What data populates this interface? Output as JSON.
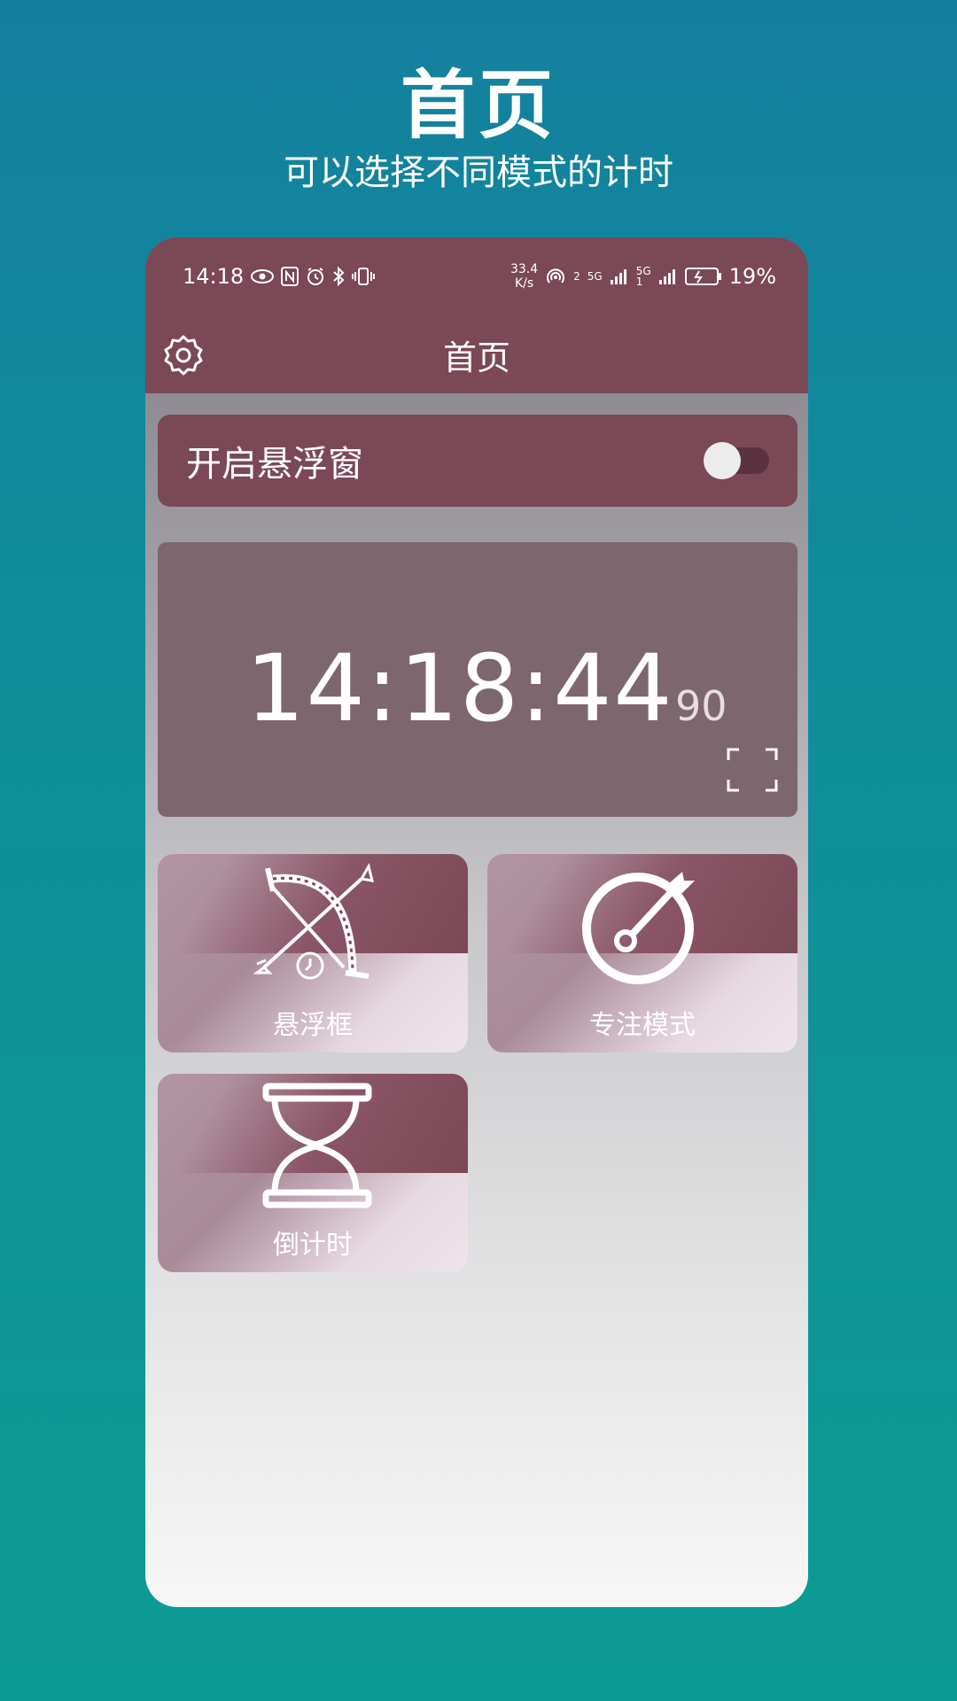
{
  "promo": {
    "title": "首页",
    "subtitle": "可以选择不同模式的计时"
  },
  "status_bar": {
    "time": "14:18",
    "net_speed_value": "33.4",
    "net_speed_unit": "K/s",
    "signal_label_1": "2",
    "signal_label_2": "5G",
    "signal_label_3": "5G",
    "signal_label_4": "1",
    "battery_percent": "19%",
    "icons": [
      "eye-icon",
      "nfc-icon",
      "alarm-icon",
      "bluetooth-icon",
      "vibrate-icon",
      "hotspot-icon",
      "signal-icon",
      "battery-icon"
    ]
  },
  "app_bar": {
    "title": "首页",
    "settings_icon": "gear-icon"
  },
  "float_window": {
    "label": "开启悬浮窗",
    "enabled": false
  },
  "clock": {
    "time": "14:18:44",
    "fraction": "90",
    "fullscreen_icon": "fullscreen-icon"
  },
  "modes": [
    {
      "label": "悬浮框",
      "icon": "bow-arrow-clock-icon"
    },
    {
      "label": "专注模式",
      "icon": "target-icon"
    },
    {
      "label": "倒计时",
      "icon": "hourglass-icon"
    }
  ],
  "colors": {
    "primary": "#7b4856",
    "background_top": "#14809e",
    "background_bottom": "#0c9b92"
  }
}
